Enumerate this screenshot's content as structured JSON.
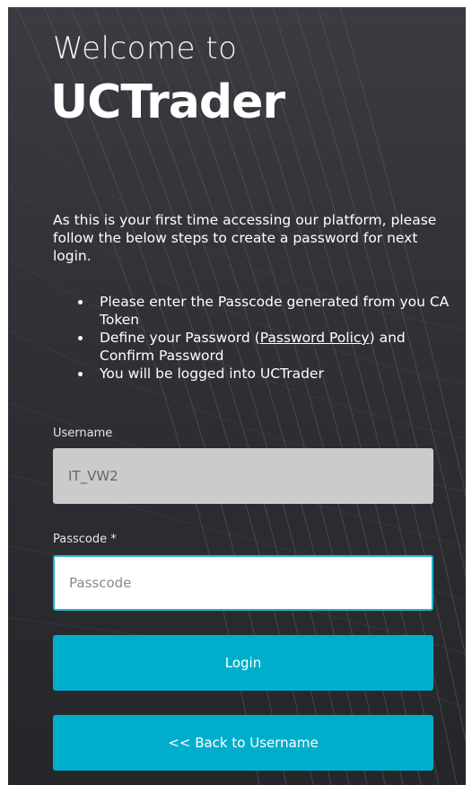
{
  "header": {
    "welcome": "Welcome to",
    "brand": "UCTrader"
  },
  "intro": {
    "text": "As this is your first time accessing our platform, please follow the below steps to create a password for next login."
  },
  "steps": {
    "item1": "Please enter the Passcode generated from you CA Token",
    "item2_before": "Define your Password (",
    "item2_link": "Password Policy",
    "item2_after": ") and Confirm Password",
    "item3": "You will be logged into UCTrader"
  },
  "form": {
    "username_label": "Username",
    "username_value": "IT_VW2",
    "passcode_label": "Passcode *",
    "passcode_placeholder": "Passcode",
    "passcode_value": ""
  },
  "buttons": {
    "login": "Login",
    "back": "<< Back to Username"
  },
  "colors": {
    "accent": "#00aecb",
    "input_focus_border": "#1fb4d2",
    "disabled_input_bg": "#cbcbcb",
    "panel_bg": "#2e3035",
    "text": "#ffffff"
  }
}
